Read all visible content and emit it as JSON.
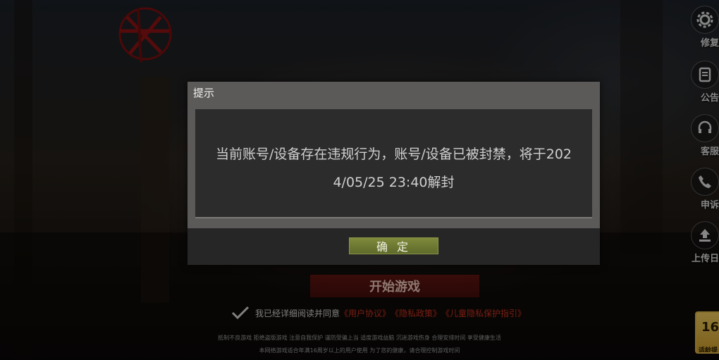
{
  "background": {
    "logo_subtitle": "",
    "start_button_label": "开始游戏",
    "agreement": {
      "prefix": "我已经详细阅读并同意",
      "user_agreement": "《用户协议》",
      "privacy_policy": "《隐私政策》",
      "child_privacy": "《儿童隐私保护指引》"
    },
    "notice_line1": "抵制不良游戏 拒绝盗版游戏 注意自我保护 谨防受骗上当 适度游戏益脑 沉迷游戏伤身 合理安排时间 享受健康生活",
    "notice_line2": "本网络游戏适合年满16周岁以上的用户使用   为了您的健康，请合理控制游戏时间"
  },
  "rail": {
    "items": [
      {
        "label": "修复",
        "icon": "gear-icon"
      },
      {
        "label": "公告",
        "icon": "notice-icon"
      },
      {
        "label": "客服",
        "icon": "headset-icon"
      },
      {
        "label": "申诉",
        "icon": "phone-icon"
      },
      {
        "label": "上传日",
        "icon": "upload-icon"
      }
    ],
    "age_badge": {
      "number": "16",
      "tag": "适龄提"
    }
  },
  "dialog": {
    "title": "提示",
    "message_line1": "当前账号/设备存在违规行为，账号/设备已被封禁，将于202",
    "message_line2": "4/05/25 23:40解封",
    "confirm_label": "确 定"
  },
  "colors": {
    "dialog_header": "#5c5a59",
    "dialog_body": "#2c2c2c",
    "confirm_button": "#6f7a33",
    "link_red": "#c7301f",
    "start_red": "#8c1a14"
  }
}
